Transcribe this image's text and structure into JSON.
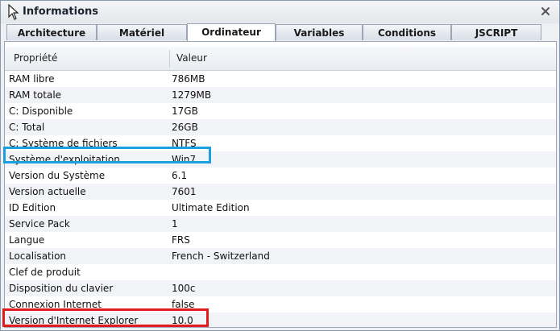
{
  "window": {
    "title": "Informations"
  },
  "tabs": [
    {
      "label": "Architecture"
    },
    {
      "label": "Matériel"
    },
    {
      "label": "Ordinateur"
    },
    {
      "label": "Variables"
    },
    {
      "label": "Conditions"
    },
    {
      "label": "JSCRIPT"
    }
  ],
  "active_tab": "Ordinateur",
  "table": {
    "columns": [
      "Propriété",
      "Valeur"
    ],
    "rows": [
      [
        "RAM libre",
        "786MB"
      ],
      [
        "RAM totale",
        "1279MB"
      ],
      [
        "C: Disponible",
        "17GB"
      ],
      [
        "C: Total",
        "26GB"
      ],
      [
        "C: Système de fichiers",
        "NTFS"
      ],
      [
        "Système d'exploitation",
        "Win7"
      ],
      [
        "Version du Système",
        "6.1"
      ],
      [
        "Version actuelle",
        "7601"
      ],
      [
        "ID Edition",
        "Ultimate Edition"
      ],
      [
        "Service Pack",
        "1"
      ],
      [
        "Langue",
        "FRS"
      ],
      [
        "Localisation",
        "French - Switzerland"
      ],
      [
        "Clef de produit",
        ""
      ],
      [
        "Disposition du clavier",
        "100c"
      ],
      [
        "Connexion Internet",
        "false"
      ],
      [
        "Version d'Internet Explorer",
        "10.0"
      ]
    ]
  },
  "colors": {
    "highlight_blue": "#1aa0de",
    "highlight_red": "#e01b1b"
  },
  "icons": {
    "title": "cursor-arrow-icon",
    "close": "close-icon"
  }
}
